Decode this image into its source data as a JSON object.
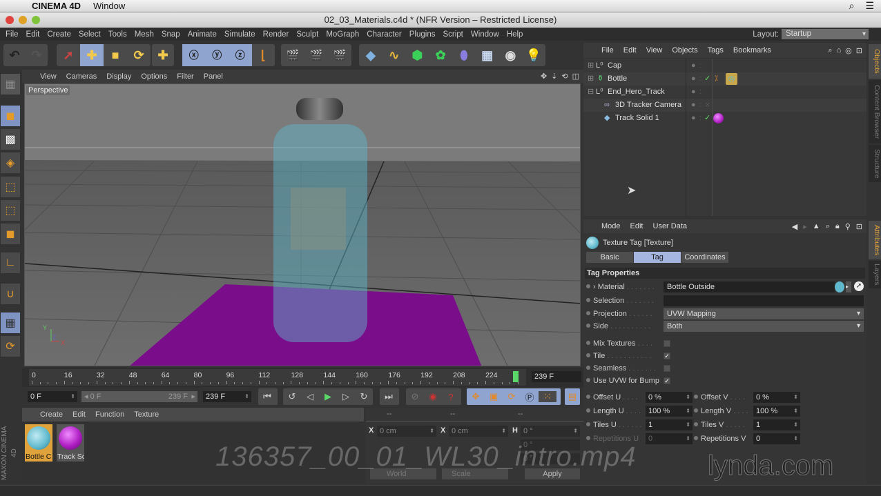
{
  "mac_menubar": {
    "app_name": "CINEMA 4D",
    "menu": "Window"
  },
  "window": {
    "title": "02_03_Materials.c4d * (NFR Version – Restricted License)"
  },
  "app_menu": [
    "File",
    "Edit",
    "Create",
    "Select",
    "Tools",
    "Mesh",
    "Snap",
    "Animate",
    "Simulate",
    "Render",
    "Sculpt",
    "MoGraph",
    "Character",
    "Plugins",
    "Script",
    "Window",
    "Help"
  ],
  "layout": {
    "label": "Layout:",
    "value": "Startup"
  },
  "toolbar": {
    "groups": [
      [
        "undo-icon",
        "redo-icon"
      ],
      [
        "select-icon",
        "move-icon",
        "scale-icon",
        "rotate-icon"
      ],
      [
        "add-icon"
      ],
      [
        "x-axis-icon",
        "y-axis-icon",
        "z-axis-icon",
        "coordinate-system-icon"
      ],
      [
        "render-view-icon",
        "render-picture-viewer-icon",
        "render-settings-icon"
      ],
      [
        "cube-icon",
        "spline-icon",
        "subdivision-icon",
        "mograph-icon",
        "deformer-icon",
        "floor-icon",
        "camera-icon",
        "light-icon"
      ]
    ]
  },
  "viewport": {
    "menu": [
      "View",
      "Cameras",
      "Display",
      "Options",
      "Filter",
      "Panel"
    ],
    "label": "Perspective",
    "axis_labels": {
      "y": "Y",
      "z": "Z",
      "x": "X"
    }
  },
  "timeline": {
    "ticks": [
      "0",
      "16",
      "32",
      "48",
      "64",
      "80",
      "96",
      "112",
      "128",
      "144",
      "160",
      "176",
      "192",
      "208",
      "224"
    ],
    "current_frame": 239,
    "max_frame": 239,
    "end_field": "239 F"
  },
  "transport": {
    "start_field": "0 F",
    "range_start": "0 F",
    "range_end": "239 F",
    "end_field": "239 F"
  },
  "material_manager": {
    "menu": [
      "Create",
      "Edit",
      "Function",
      "Texture"
    ],
    "materials": [
      {
        "name": "Bottle C",
        "color": "#5fb8cc",
        "selected": true
      },
      {
        "name": "Track Sc",
        "color": "#b01fc4",
        "selected": false
      }
    ]
  },
  "coordinate_manager": {
    "headers": [
      "--",
      "--",
      "--"
    ],
    "rows": [
      {
        "l1": "X",
        "v1": "0 cm",
        "l2": "X",
        "v2": "0 cm",
        "l3": "H",
        "v3": "0 °"
      },
      {
        "l1": "",
        "v1": "",
        "l2": "",
        "v2": "",
        "l3": "",
        "v3": "0 °"
      },
      {
        "l1": "",
        "v1": "",
        "l2": "",
        "v2": "",
        "l3": "",
        "v3": "0 °"
      }
    ],
    "space_select": "World",
    "mode_select": "Scale",
    "apply_label": "Apply"
  },
  "objects_panel": {
    "menu": [
      "File",
      "Edit",
      "View",
      "Objects",
      "Tags",
      "Bookmarks"
    ],
    "objects": [
      {
        "name": "Cap",
        "indent": 0,
        "icon": "null-object-icon",
        "check": false,
        "tags": []
      },
      {
        "name": "Bottle",
        "indent": 0,
        "icon": "bottle-object-icon",
        "check": true,
        "tags": [
          "phong-tag-icon",
          "texture-tag-icon"
        ]
      },
      {
        "name": "End_Hero_Track",
        "indent": 0,
        "icon": "null-object-icon",
        "check": false,
        "tags": []
      },
      {
        "name": "3D Tracker Camera",
        "indent": 1,
        "icon": "camera-object-icon",
        "check": false,
        "tags": []
      },
      {
        "name": "Track Solid 1",
        "indent": 1,
        "icon": "plane-object-icon",
        "check": true,
        "tags": [
          "material-tag-icon"
        ]
      }
    ]
  },
  "side_tabs_top": [
    "Objects",
    "Content Browser",
    "Structure"
  ],
  "side_tabs_bottom": [
    "Attributes",
    "Layers"
  ],
  "attributes": {
    "menu": [
      "Mode",
      "Edit",
      "User Data"
    ],
    "object_title": "Texture Tag [Texture]",
    "tabs": [
      "Basic",
      "Tag",
      "Coordinates"
    ],
    "active_tab": "Tag",
    "section": "Tag Properties",
    "material_label": "Material",
    "material_value": "Bottle Outside",
    "selection_label": "Selection",
    "selection_value": "",
    "projection_label": "Projection",
    "projection_value": "UVW Mapping",
    "side_label": "Side",
    "side_value": "Both",
    "checkboxes": [
      {
        "label": "Mix Textures",
        "checked": false
      },
      {
        "label": "Tile",
        "checked": true
      },
      {
        "label": "Seamless",
        "checked": false
      },
      {
        "label": "Use UVW for Bump",
        "checked": true
      }
    ],
    "numeric": [
      {
        "label": "Offset U",
        "value": "0 %",
        "label2": "Offset V",
        "value2": "0 %"
      },
      {
        "label": "Length U",
        "value": "100 %",
        "label2": "Length V",
        "value2": "100 %"
      },
      {
        "label": "Tiles U",
        "value": "1",
        "label2": "Tiles V",
        "value2": "1"
      },
      {
        "label": "Repetitions U",
        "value": "0",
        "label2": "Repetitions V",
        "value2": "0"
      }
    ]
  },
  "overlay": {
    "watermark": "136357_00_01_WL30_intro.mp4",
    "brand": "lynda.com",
    "maxon_logo": "MAXON CINEMA 4D"
  },
  "colors": {
    "accent_blue": "#8fa4cf",
    "accent_orange": "#e0a23a",
    "floor_purple": "#7a0e8a",
    "bottle_cyan": "#5fb8cc"
  }
}
